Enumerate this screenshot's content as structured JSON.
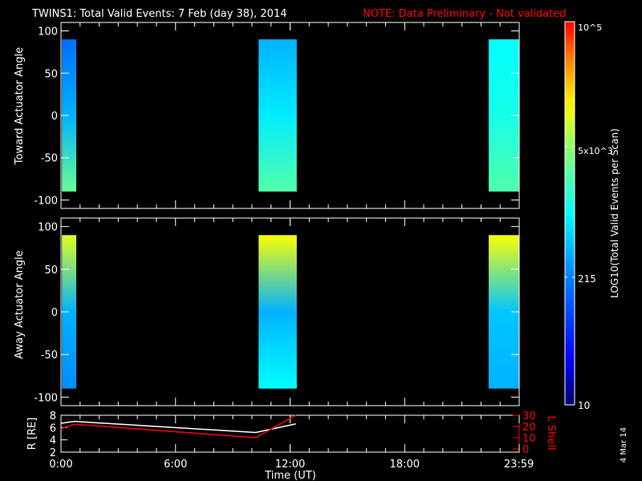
{
  "title": "TWINS1: Total Valid Events:  7 Feb (day  38), 2014",
  "note": "NOTE: Data Preliminary - Not validated",
  "side_date": "4 Mar 14",
  "colors": {
    "axis": "#ffffff",
    "note": "#ff0000",
    "l_shell": "#ff0000",
    "radius": "#ffffff"
  },
  "chart_data": [
    {
      "type": "heatmap",
      "ylabel": "Toward Actuator Angle",
      "ylim": [
        -110,
        110
      ],
      "yticks": [
        "100",
        "50",
        "0",
        "-50",
        "-100"
      ],
      "xlim_hours": [
        0,
        24
      ],
      "blocks": [
        {
          "start_h": 0.05,
          "end_h": 0.8,
          "angle_range": [
            -90,
            90
          ],
          "log_counts_top_mid_bottom": [
            2.2,
            2.6,
            3.5
          ]
        },
        {
          "start_h": 10.35,
          "end_h": 12.35,
          "angle_range": [
            -90,
            90
          ],
          "log_counts_top_mid_bottom": [
            2.6,
            2.9,
            3.4
          ]
        },
        {
          "start_h": 22.4,
          "end_h": 24.0,
          "angle_range": [
            -90,
            90
          ],
          "log_counts_top_mid_bottom": [
            3.0,
            3.1,
            3.4
          ]
        }
      ]
    },
    {
      "type": "heatmap",
      "ylabel": "Away Actuator Angle",
      "ylim": [
        -110,
        110
      ],
      "yticks": [
        "100",
        "50",
        "0",
        "-50",
        "-100"
      ],
      "xlim_hours": [
        0,
        24
      ],
      "blocks": [
        {
          "start_h": 0.05,
          "end_h": 0.8,
          "angle_range": [
            -90,
            90
          ],
          "log_counts_top_mid_bottom": [
            4.0,
            2.6,
            2.4
          ]
        },
        {
          "start_h": 10.35,
          "end_h": 12.35,
          "angle_range": [
            -90,
            90
          ],
          "log_counts_top_mid_bottom": [
            4.1,
            2.6,
            3.0
          ]
        },
        {
          "start_h": 22.4,
          "end_h": 24.0,
          "angle_range": [
            -90,
            90
          ],
          "log_counts_top_mid_bottom": [
            4.1,
            2.7,
            2.6
          ]
        }
      ]
    },
    {
      "type": "line",
      "ylabel": "R [RE]",
      "y2label": "L Shell",
      "ylim": [
        2,
        8
      ],
      "y2lim": [
        0,
        30
      ],
      "yticks": [
        "2",
        "4",
        "6",
        "8"
      ],
      "y2ticks": [
        "0",
        "10",
        "20",
        "30"
      ],
      "series": [
        {
          "name": "R",
          "x_hours": [
            0,
            0.7,
            10.2,
            12.3
          ],
          "y": [
            6.7,
            7.0,
            5.2,
            6.6
          ]
        },
        {
          "name": "L Shell",
          "x_hours": [
            0,
            0.7,
            10.2,
            12.3
          ],
          "y": [
            18,
            22,
            10,
            30
          ]
        }
      ]
    }
  ],
  "xaxis": {
    "label": "Time (UT)",
    "ticks": [
      "0:00",
      "6:00",
      "12:00",
      "18:00",
      "23:59"
    ]
  },
  "colorbar": {
    "label": "LOG10(Total Valid Events per Scan)",
    "ticks": [
      "10",
      "215",
      "5x10^3",
      "10^5"
    ],
    "log_range": [
      1,
      5
    ]
  }
}
